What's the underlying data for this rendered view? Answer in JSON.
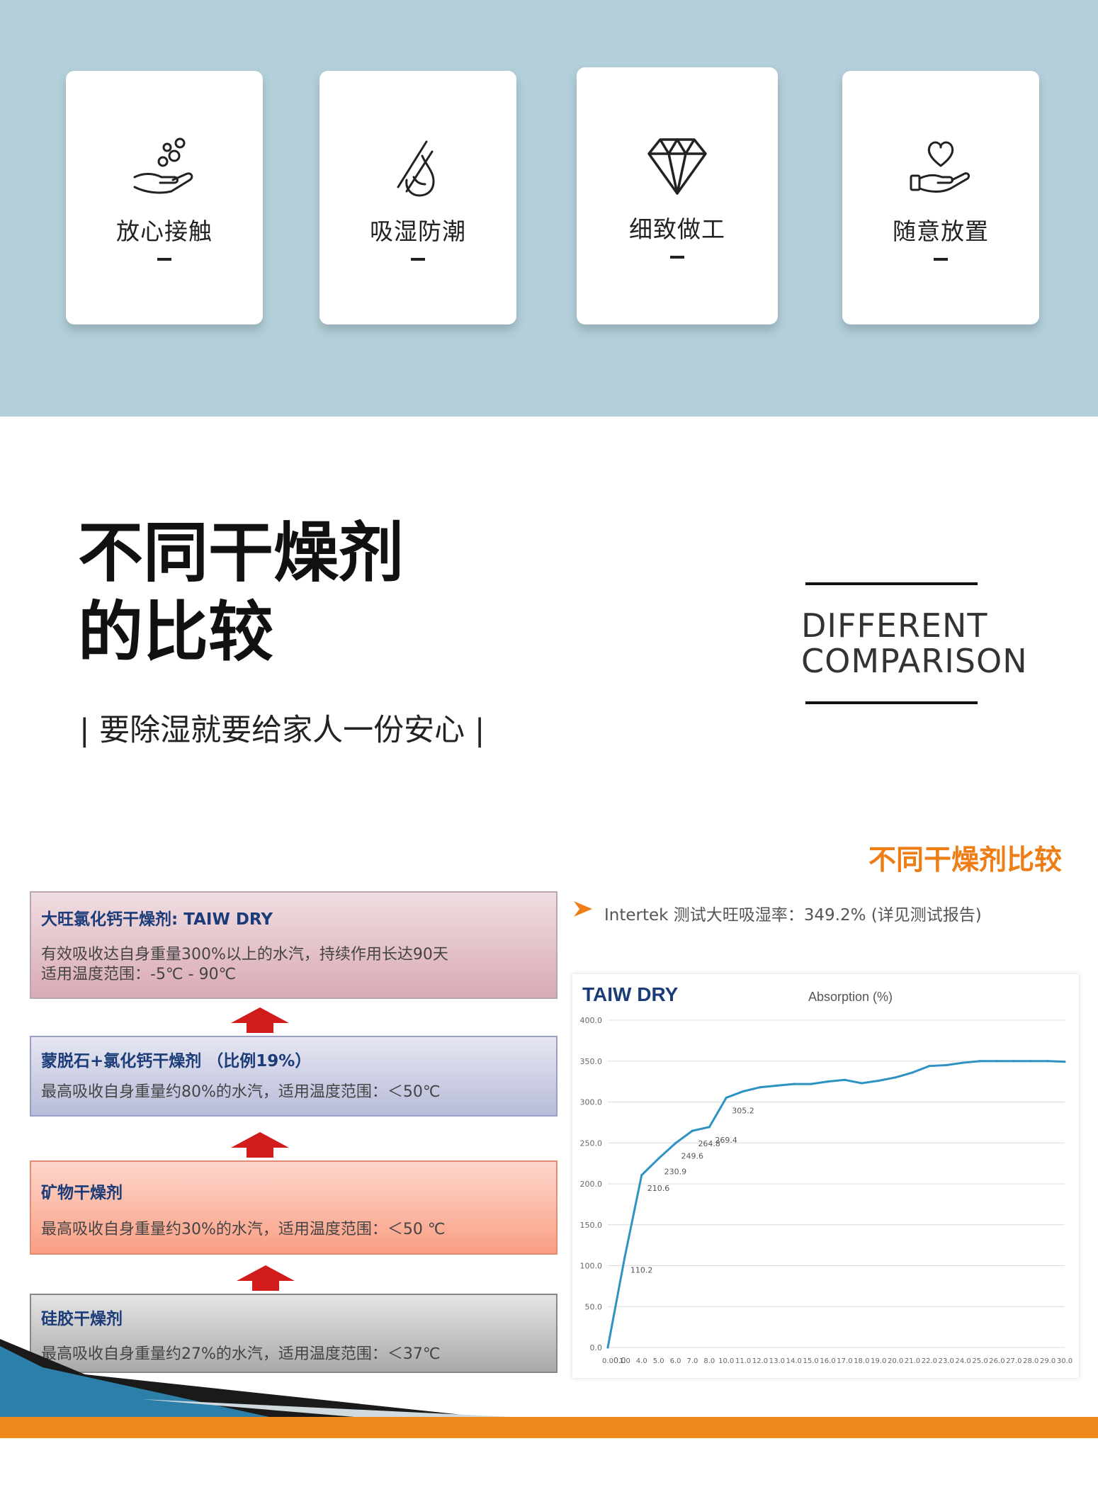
{
  "features": [
    {
      "label": "放心接触",
      "icon": "hand-bubbles-icon"
    },
    {
      "label": "吸湿防潮",
      "icon": "droplet-slash-icon"
    },
    {
      "label": "细致做工",
      "icon": "diamond-icon"
    },
    {
      "label": "随意放置",
      "icon": "heart-hand-icon"
    }
  ],
  "heading": {
    "title_line1": "不同干燥剂",
    "title_line2": "的比较",
    "subtitle": "| 要除湿就要给家人一份安心 |",
    "english_line1": "DIFFERENT",
    "english_line2": "COMPARISON"
  },
  "comparison": {
    "title": "不同干燥剂比较",
    "test_note": "Intertek 测试大旺吸湿率：349.2% (详见测试报告)",
    "boxes": [
      {
        "title": "大旺氯化钙干燥剂: TAIW DRY",
        "line1": "有效吸收达自身重量300%以上的水汽，持续作用长达90天",
        "line2": "适用温度范围：-5℃ - 90℃"
      },
      {
        "title": "蒙脱石+氯化钙干燥剂 （比例19%）",
        "line1": "最高吸收自身重量约80%的水汽，适用温度范围：＜50℃",
        "line2": ""
      },
      {
        "title": "矿物干燥剂",
        "line1": "最高吸收自身重量约30%的水汽，适用温度范围：＜50 ℃",
        "line2": ""
      },
      {
        "title": "硅胶干燥剂",
        "line1": "最高吸收自身重量约27%的水汽，适用温度范围：＜37℃",
        "line2": ""
      }
    ],
    "colors": {
      "box1": "#e4c2c9",
      "box2": "#c9cde4",
      "box3": "#fbb7a4",
      "box4": "#b6b6b6",
      "arrow": "#d21c1c",
      "accent": "#ef7d16",
      "line": "#2e93c2"
    }
  },
  "chart_data": {
    "type": "line",
    "brand": "TAIW DRY",
    "title": "Absorption (%)",
    "x": [
      0,
      10,
      40,
      50,
      60,
      70,
      80,
      100,
      110,
      120,
      130,
      140,
      150,
      160,
      170,
      180,
      190,
      200,
      210,
      220,
      230,
      240,
      250,
      260,
      270,
      280,
      290,
      300
    ],
    "y": [
      0.0,
      110.2,
      210.6,
      230.9,
      249.6,
      264.8,
      269.4,
      305.2,
      313,
      318,
      320,
      322,
      322,
      325,
      327,
      323,
      326,
      330,
      336,
      344,
      345,
      348,
      350,
      350,
      350,
      350,
      350,
      349.2
    ],
    "point_labels": [
      {
        "i": 0,
        "text": "0.0"
      },
      {
        "i": 1,
        "text": "110.2"
      },
      {
        "i": 2,
        "text": "210.6"
      },
      {
        "i": 3,
        "text": "230.9"
      },
      {
        "i": 4,
        "text": "249.6"
      },
      {
        "i": 5,
        "text": "264.8"
      },
      {
        "i": 6,
        "text": "269.4"
      },
      {
        "i": 7,
        "text": "305.2"
      }
    ],
    "ylim": [
      0,
      400
    ],
    "yticks": [
      "0.0",
      "50.0",
      "100.0",
      "150.0",
      "200.0",
      "250.0",
      "300.0",
      "350.0",
      "400.0"
    ],
    "xticks": [
      "0.0",
      "1.0",
      "4.0",
      "5.0",
      "6.0",
      "7.0",
      "8.0",
      "10.0",
      "11.0",
      "12.0",
      "13.0",
      "14.0",
      "15.0",
      "16.0",
      "17.0",
      "18.0",
      "19.0",
      "20.0",
      "21.0",
      "22.0",
      "23.0",
      "24.0",
      "25.0",
      "26.0",
      "27.0",
      "28.0",
      "29.0",
      "30.0"
    ],
    "grid": true
  }
}
